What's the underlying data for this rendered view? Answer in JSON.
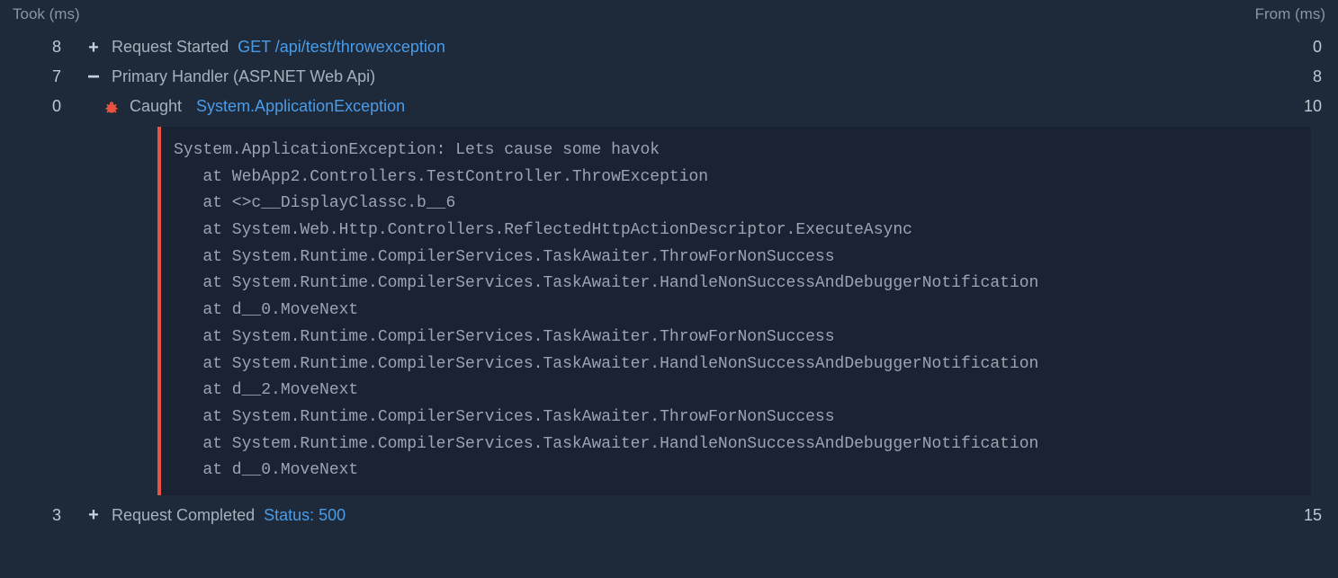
{
  "header": {
    "took_label": "Took (ms)",
    "from_label": "From (ms)"
  },
  "rows": [
    {
      "took": "8",
      "from": "0",
      "icon": "plus",
      "indent": 0,
      "label": "Request Started",
      "link": "GET /api/test/throwexception"
    },
    {
      "took": "7",
      "from": "8",
      "icon": "minus",
      "indent": 0,
      "label": "Primary Handler (ASP.NET Web Api)",
      "link": ""
    },
    {
      "took": "0",
      "from": "10",
      "icon": "bug",
      "indent": 1,
      "label": "Caught",
      "link": "System.ApplicationException"
    }
  ],
  "stacktrace": [
    "System.ApplicationException: Lets cause some havok",
    "   at WebApp2.Controllers.TestController.ThrowException",
    "   at <>c__DisplayClassc.b__6",
    "   at System.Web.Http.Controllers.ReflectedHttpActionDescriptor.ExecuteAsync",
    "   at System.Runtime.CompilerServices.TaskAwaiter.ThrowForNonSuccess",
    "   at System.Runtime.CompilerServices.TaskAwaiter.HandleNonSuccessAndDebuggerNotification",
    "   at d__0.MoveNext",
    "   at System.Runtime.CompilerServices.TaskAwaiter.ThrowForNonSuccess",
    "   at System.Runtime.CompilerServices.TaskAwaiter.HandleNonSuccessAndDebuggerNotification",
    "   at d__2.MoveNext",
    "   at System.Runtime.CompilerServices.TaskAwaiter.ThrowForNonSuccess",
    "   at System.Runtime.CompilerServices.TaskAwaiter.HandleNonSuccessAndDebuggerNotification",
    "   at d__0.MoveNext"
  ],
  "footer_row": {
    "took": "3",
    "from": "15",
    "icon": "plus",
    "indent": 0,
    "label": "Request Completed",
    "link": "Status: 500"
  }
}
